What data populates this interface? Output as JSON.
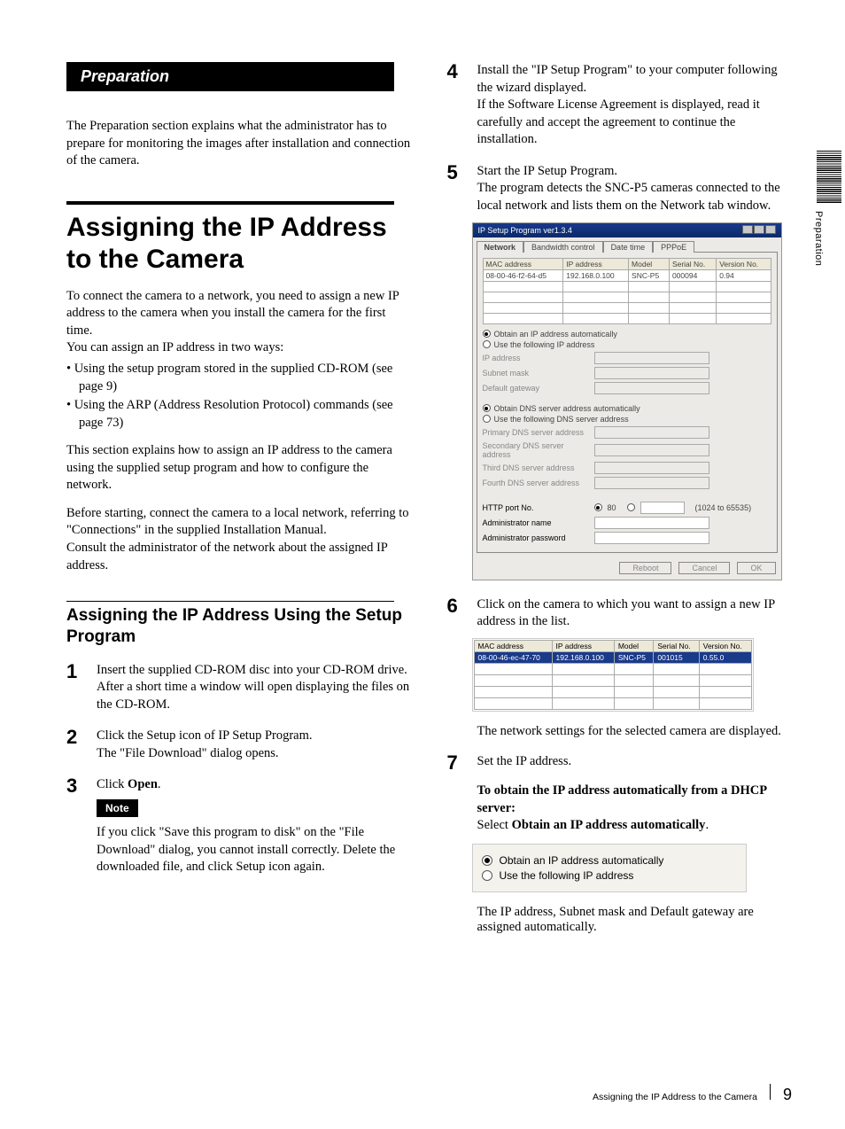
{
  "sideTab": {
    "label": "Preparation"
  },
  "left": {
    "banner": "Preparation",
    "introPara": "The Preparation section explains what the administrator has to prepare for monitoring the images after installation and connection of the camera.",
    "h1": "Assigning the IP Address to the Camera",
    "p1": "To connect the camera to a network, you need to assign a new IP address to the camera when you install the camera for the first time.",
    "p2": "You can assign an IP address in two ways:",
    "bullets": [
      "Using the setup program stored in the supplied CD-ROM (see page 9)",
      "Using the ARP (Address Resolution Protocol) commands (see page 73)"
    ],
    "p3": "This section explains how to assign an IP address to the camera using the supplied setup program and how to configure the network.",
    "p4a": "Before starting, connect the camera to a local network, referring to \"Connections\" in the supplied Installation Manual.",
    "p4b": "Consult the administrator of the network about the assigned IP address.",
    "h2": "Assigning the IP Address Using the Setup Program",
    "step1": {
      "num": "1",
      "a": "Insert the supplied CD-ROM disc into your CD-ROM drive.",
      "b": "After a short time a window will open displaying the files on the CD-ROM."
    },
    "step2": {
      "num": "2",
      "a": "Click the Setup icon of IP Setup Program.",
      "b": "The \"File Download\" dialog opens."
    },
    "step3": {
      "num": "3",
      "aPrefix": "Click ",
      "aBold": "Open",
      "aSuffix": ".",
      "noteLabel": "Note",
      "note": "If you click \"Save this program to disk\" on the \"File Download\" dialog, you cannot install correctly. Delete the downloaded file, and click Setup icon again."
    }
  },
  "right": {
    "step4": {
      "num": "4",
      "a": "Install the \"IP Setup Program\" to your computer following the wizard displayed.",
      "b": "If the Software License Agreement is displayed, read it carefully and accept the agreement to continue the installation."
    },
    "step5": {
      "num": "5",
      "a": "Start the IP Setup Program.",
      "b": "The program detects the SNC-P5 cameras connected to the local network and lists them on the Network tab window."
    },
    "figWindow": {
      "title": "IP Setup Program ver1.3.4",
      "tabs": [
        "Network",
        "Bandwidth control",
        "Date time",
        "PPPoE"
      ],
      "headers": [
        "MAC address",
        "IP address",
        "Model",
        "Serial No.",
        "Version No."
      ],
      "row": [
        "08-00-46-f2-64-d5",
        "192.168.0.100",
        "SNC-P5",
        "000094",
        "0.94"
      ],
      "radioIP1": "Obtain an IP address automatically",
      "radioIP2": "Use the following IP address",
      "lblIP": "IP address",
      "lblSubnet": "Subnet mask",
      "lblGateway": "Default gateway",
      "radioDNS1": "Obtain DNS server address automatically",
      "radioDNS2": "Use the following DNS server address",
      "lblDNS1": "Primary DNS server address",
      "lblDNS2": "Secondary DNS server address",
      "lblDNS3": "Third DNS server address",
      "lblDNS4": "Fourth DNS server address",
      "lblHTTP": "HTTP port No.",
      "httpDefault": "80",
      "httpRange": "(1024 to 65535)",
      "lblAdminName": "Administrator name",
      "lblAdminPass": "Administrator password",
      "btnReboot": "Reboot",
      "btnCancel": "Cancel",
      "btnOK": "OK"
    },
    "step6": {
      "num": "6",
      "a": "Click on the camera to which you want to assign a new IP address in the list.",
      "tableHeaders": [
        "MAC address",
        "IP address",
        "Model",
        "Serial No.",
        "Version No."
      ],
      "tableRow": [
        "08-00-46-ec-47-70",
        "192.168.0.100",
        "SNC-P5",
        "001015",
        "0.55.0"
      ],
      "b": "The network settings for the selected camera are displayed."
    },
    "step7": {
      "num": "7",
      "a": "Set the IP address.",
      "hdr": "To obtain the IP address automatically from a DHCP server:",
      "selPrefix": "Select ",
      "selBold": "Obtain an IP address automatically",
      "selSuffix": ".",
      "opt1": "Obtain an IP address automatically",
      "opt2": "Use the following IP address",
      "b": "The IP address, Subnet mask and Default gateway are assigned automatically."
    }
  },
  "footer": {
    "title": "Assigning the IP Address to the Camera",
    "page": "9"
  }
}
